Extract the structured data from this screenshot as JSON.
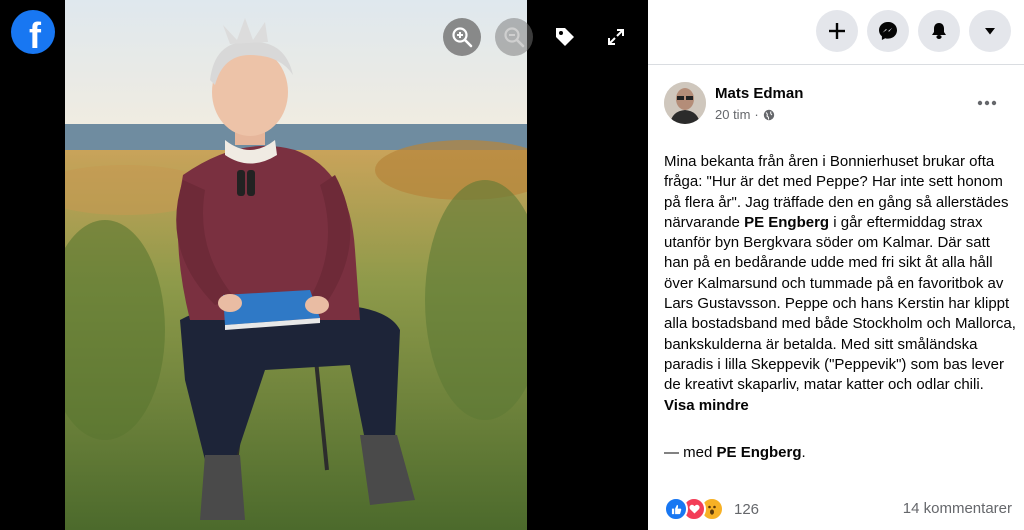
{
  "viewer": {
    "logo_letter": "f"
  },
  "icons": {
    "logo": "facebook-logo",
    "zoom_in": "zoom-in-icon",
    "zoom_out": "zoom-out-icon",
    "tag": "tag-icon",
    "expand": "expand-icon",
    "plus": "plus-icon",
    "messenger": "messenger-icon",
    "bell": "bell-icon",
    "caret": "caret-down-icon",
    "more": "more-icon",
    "globe": "globe-icon"
  },
  "post": {
    "author": "Mats Edman",
    "time": "20 tim",
    "separator": "·",
    "text_part1": "Mina bekanta från åren i Bonnierhuset brukar ofta fråga: \"Hur är det med Peppe? Har inte sett honom på flera år\". Jag träffade den en gång så allerstädes närvarande ",
    "tagged_name": "PE Engberg",
    "text_part2": " i går eftermiddag strax utanför byn Bergkvara söder om Kalmar. Där satt han på en bedårande udde med fri sikt åt alla håll över Kalmarsund och tummade på en favoritbok av Lars Gustavsson. Peppe och hans Kerstin har klippt alla bostadsband med både Stockholm och Mallorca, bankskulderna är betalda. Med sitt småländska paradis i lilla Skeppevik (\"Peppevik\") som bas lever de kreativt skaparliv, matar katter och odlar chili. ",
    "see_less": "Visa mindre",
    "with_prefix": "— med ",
    "with_name": "PE Engberg",
    "with_suffix": "."
  },
  "reactions": {
    "count": "126",
    "comments": "14 kommentarer",
    "like_color": "#1877f2",
    "love_color": "#f33e58",
    "wow_color": "#f7b125"
  },
  "colors": {
    "brand": "#1877f2",
    "button_bg": "#e4e6eb",
    "text_secondary": "#65676b"
  }
}
